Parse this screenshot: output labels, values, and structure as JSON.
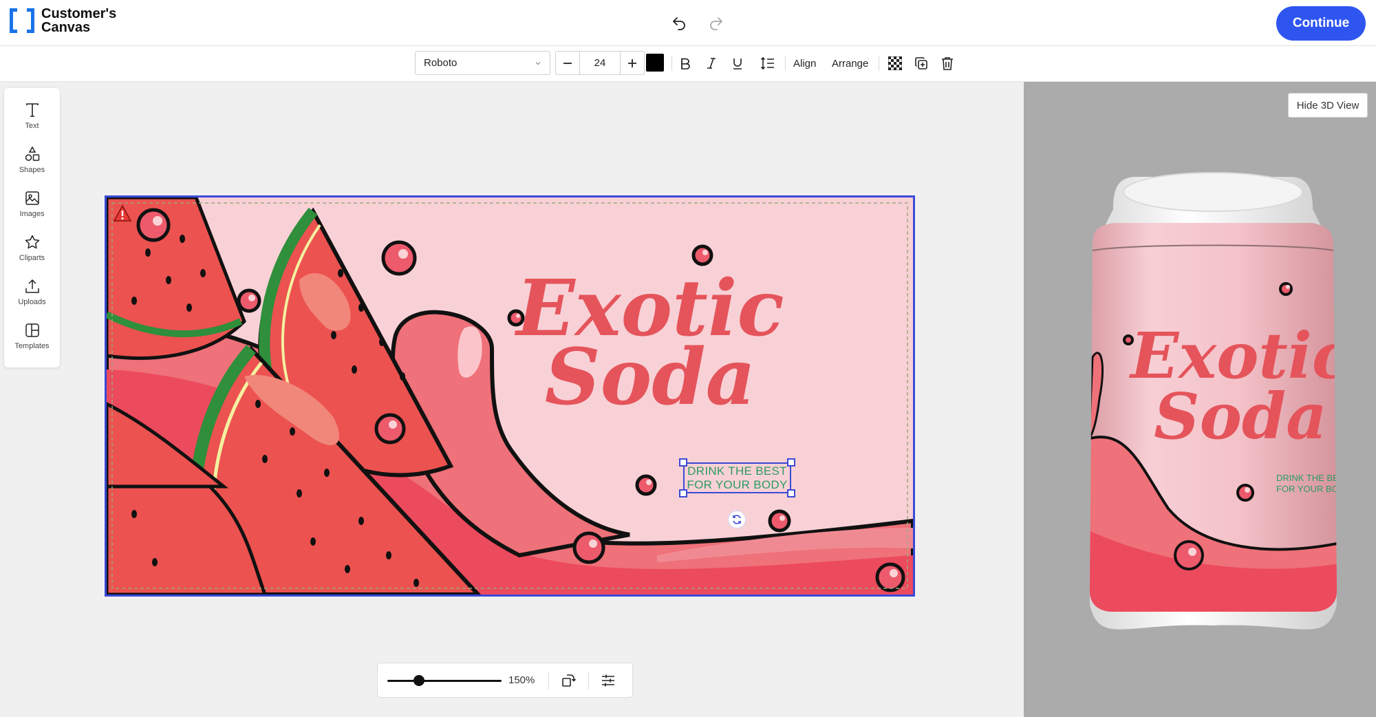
{
  "app": {
    "logo_line1": "Customer's",
    "logo_line2": "Canvas",
    "continue_label": "Continue"
  },
  "toolbar": {
    "font_family": "Roboto",
    "font_size": "24",
    "text_color": "#000000",
    "align_label": "Align",
    "arrange_label": "Arrange"
  },
  "tools": [
    {
      "label": "Text",
      "icon": "text-icon"
    },
    {
      "label": "Shapes",
      "icon": "shapes-icon"
    },
    {
      "label": "Images",
      "icon": "image-icon"
    },
    {
      "label": "Cliparts",
      "icon": "star-icon"
    },
    {
      "label": "Uploads",
      "icon": "upload-icon"
    },
    {
      "label": "Templates",
      "icon": "templates-icon"
    }
  ],
  "design": {
    "title_line1": "Exotic",
    "title_line2": "Soda",
    "tagline_line1": "DRINK THE BEST",
    "tagline_line2": "FOR YOUR BODY",
    "title_color": "#e5545b",
    "tagline_color": "#2c9a62",
    "background_color": "#f8d1d6"
  },
  "zoom": {
    "value": "150%",
    "level": 0.25
  },
  "view3d": {
    "hide_label": "Hide 3D View",
    "can_title_line1": "Exotic",
    "can_title_line2": "Soda",
    "can_tagline_line1": "DRINK THE BE",
    "can_tagline_line2": "FOR YOUR BC"
  },
  "colors": {
    "accent": "#2f55f1",
    "selection": "#3a4ad6"
  }
}
